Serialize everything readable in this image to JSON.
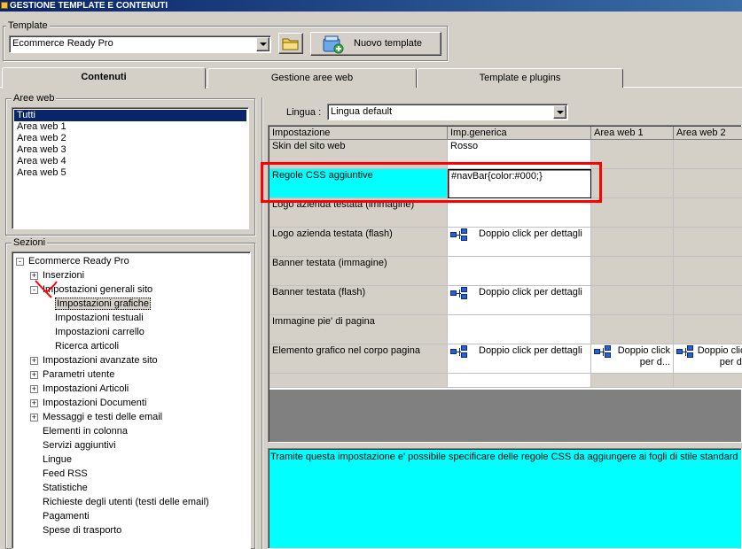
{
  "window": {
    "title": "GESTIONE TEMPLATE E CONTENUTI"
  },
  "template": {
    "group_label": "Template",
    "selected": "Ecommerce Ready Pro",
    "new_button_label": "Nuovo template"
  },
  "tabs": [
    {
      "label": "Contenuti",
      "active": true
    },
    {
      "label": "Gestione aree web",
      "active": false
    },
    {
      "label": "Template e plugins",
      "active": false
    }
  ],
  "aree_web": {
    "group_label": "Aree web",
    "items": [
      "Tutti",
      "Area web 1",
      "Area web 2",
      "Area web 3",
      "Area web 4",
      "Area web 5"
    ],
    "selected_index": 0
  },
  "sezioni": {
    "group_label": "Sezioni",
    "tree": [
      {
        "label": "Ecommerce Ready Pro",
        "level": 0,
        "expander": "-"
      },
      {
        "label": "Inserzioni",
        "level": 1,
        "expander": "+"
      },
      {
        "label": "Impostazioni generali sito",
        "level": 1,
        "expander": "-"
      },
      {
        "label": "Impostazioni grafiche",
        "level": 2,
        "expander": "",
        "selected": true
      },
      {
        "label": "Impostazioni testuali",
        "level": 2,
        "expander": ""
      },
      {
        "label": "Impostazioni carrello",
        "level": 2,
        "expander": ""
      },
      {
        "label": "Ricerca articoli",
        "level": 2,
        "expander": ""
      },
      {
        "label": "Impostazioni avanzate sito",
        "level": 1,
        "expander": "+"
      },
      {
        "label": "Parametri utente",
        "level": 1,
        "expander": "+"
      },
      {
        "label": "Impostazioni Articoli",
        "level": 1,
        "expander": "+"
      },
      {
        "label": "Impostazioni Documenti",
        "level": 1,
        "expander": "+"
      },
      {
        "label": "Messaggi e testi delle email",
        "level": 1,
        "expander": "+"
      },
      {
        "label": "Elementi in colonna",
        "level": 1,
        "expander": ""
      },
      {
        "label": "Servizi aggiuntivi",
        "level": 1,
        "expander": ""
      },
      {
        "label": "Lingue",
        "level": 1,
        "expander": ""
      },
      {
        "label": "Feed RSS",
        "level": 1,
        "expander": ""
      },
      {
        "label": "Statistiche",
        "level": 1,
        "expander": ""
      },
      {
        "label": "Richieste degli utenti (testi delle email)",
        "level": 1,
        "expander": ""
      },
      {
        "label": "Pagamenti",
        "level": 1,
        "expander": ""
      },
      {
        "label": "Spese di trasporto",
        "level": 1,
        "expander": ""
      }
    ]
  },
  "lingua": {
    "label": "Lingua :",
    "selected": "Lingua default"
  },
  "grid": {
    "columns": [
      "Impostazione",
      "Imp.generica",
      "Area web 1",
      "Area web 2"
    ],
    "rows": [
      {
        "name": "Skin del sito web",
        "generic": "Rosso"
      },
      {
        "name": "Regole CSS aggiuntive",
        "generic": "#navBar{color:#000;}",
        "selected": true
      },
      {
        "name": "Logo azienda testata (immagine)",
        "generic": ""
      },
      {
        "name": "Logo azienda testata (flash)",
        "generic": "Doppio click per dettagli",
        "icon": true
      },
      {
        "name": "Banner testata (immagine)",
        "generic": ""
      },
      {
        "name": "Banner testata (flash)",
        "generic": "Doppio click per dettagli",
        "icon": true
      },
      {
        "name": "Immagine pie' di pagina",
        "generic": ""
      },
      {
        "name": "Elemento grafico nel corpo pagina",
        "generic": "Doppio click per dettagli",
        "icon": true,
        "area1": "Doppio click per d...",
        "area2": "Doppio click per d..."
      }
    ]
  },
  "description": "Tramite questa impostazione e' possibile specificare delle regole CSS da aggiungere ai fogli di stile standard",
  "colors": {
    "highlight": "#00ffff",
    "selection": "#0a246a",
    "annotation": "#ff0000"
  },
  "icons": [
    "folder-icon",
    "new-template-icon",
    "detail-icon"
  ]
}
